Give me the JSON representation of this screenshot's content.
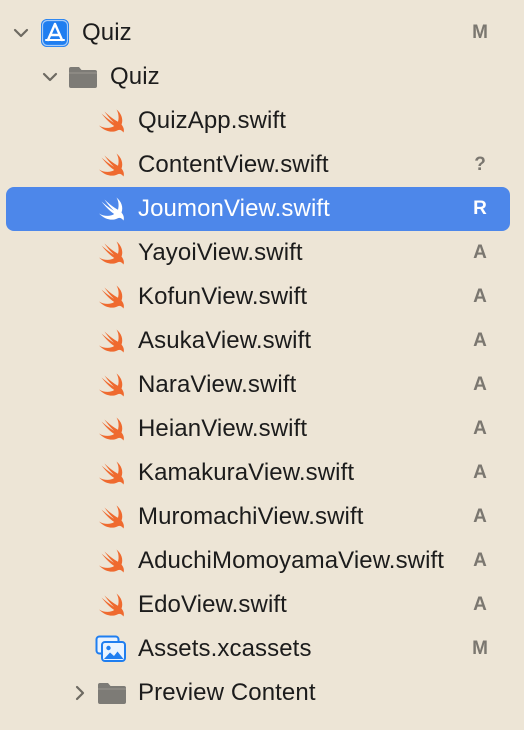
{
  "tree": {
    "project": {
      "label": "Quiz",
      "status": "M",
      "icon": "xcode-project-icon",
      "expanded": true
    },
    "group": {
      "label": "Quiz",
      "icon": "folder-icon",
      "expanded": true
    },
    "files": [
      {
        "label": "QuizApp.swift",
        "status": "",
        "icon": "swift-icon"
      },
      {
        "label": "ContentView.swift",
        "status": "?",
        "icon": "swift-icon"
      },
      {
        "label": "JoumonView.swift",
        "status": "R",
        "icon": "swift-icon",
        "selected": true
      },
      {
        "label": "YayoiView.swift",
        "status": "A",
        "icon": "swift-icon"
      },
      {
        "label": "KofunView.swift",
        "status": "A",
        "icon": "swift-icon"
      },
      {
        "label": "AsukaView.swift",
        "status": "A",
        "icon": "swift-icon"
      },
      {
        "label": "NaraView.swift",
        "status": "A",
        "icon": "swift-icon"
      },
      {
        "label": "HeianView.swift",
        "status": "A",
        "icon": "swift-icon"
      },
      {
        "label": "KamakuraView.swift",
        "status": "A",
        "icon": "swift-icon"
      },
      {
        "label": "MuromachiView.swift",
        "status": "A",
        "icon": "swift-icon"
      },
      {
        "label": "AduchiMomoyamaView.swift",
        "status": "A",
        "icon": "swift-icon"
      },
      {
        "label": "EdoView.swift",
        "status": "A",
        "icon": "swift-icon"
      },
      {
        "label": "Assets.xcassets",
        "status": "M",
        "icon": "asset-catalog-icon"
      }
    ],
    "preview_folder": {
      "label": "Preview Content",
      "icon": "folder-icon",
      "expanded": false
    }
  },
  "colors": {
    "background": "#ede5d6",
    "selection": "#4d87ea",
    "swift_orange": "#ef6a2f",
    "folder_gray": "#7d7b76",
    "status_gray": "#7b7770",
    "xcode_blue": "#1f7ef0"
  }
}
